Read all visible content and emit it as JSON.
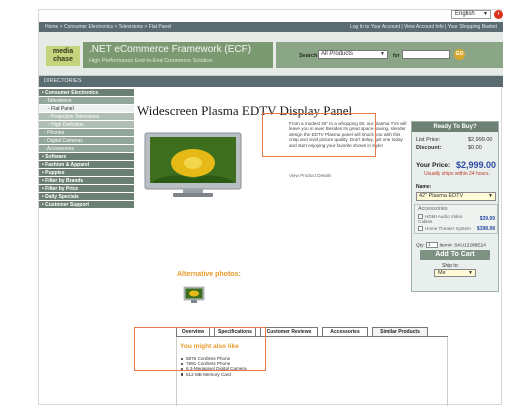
{
  "language": {
    "value": "English"
  },
  "topbar": {
    "breadcrumb": "Home > Consumer Electronics > Televisions > Flat Panel",
    "account_links": "Log In to Your Account | View Account Info | Your Shopping Basket"
  },
  "header": {
    "logo_line1": "media",
    "logo_line2": "chase",
    "brand_title": ".NET eCommerce Framework (ECF)",
    "brand_sub": "High Performance End-to-End Commerce Solution",
    "search_label": "Search",
    "search_category": "All Products",
    "for_label": "for",
    "search_value": "",
    "go_label": "GO"
  },
  "directories_label": "DIRECTORIES",
  "sidebar": {
    "items": [
      {
        "label": "Consumer Electronics",
        "level": 0
      },
      {
        "label": "Televisions",
        "level": 1
      },
      {
        "label": "Flat Panel",
        "level": 2,
        "active": true
      },
      {
        "label": "Projection Televisions",
        "level": 2
      },
      {
        "label": "High Definition",
        "level": 2
      },
      {
        "label": "Phones",
        "level": 1
      },
      {
        "label": "Digital Cameras",
        "level": 1
      },
      {
        "label": "Accessories",
        "level": 1
      },
      {
        "label": "Software",
        "level": 0
      },
      {
        "label": "Fashion & Apparel",
        "level": 0
      },
      {
        "label": "Puppies",
        "level": 0
      },
      {
        "label": "Filter by Brands",
        "level": 0
      },
      {
        "label": "Filter by Price",
        "level": 0
      },
      {
        "label": "Daily Specials",
        "level": 0
      },
      {
        "label": "Customer Support",
        "level": 0
      }
    ]
  },
  "product": {
    "title": "Widescreen Plasma EDTV Display Panel",
    "description": "From a modest 36\" to a whopping 60, our plasma TVs will leave you in awe! Besides its great space-saving, slender design the EDTV Plasma panel will shock you with this crisp and vivid picture quality. Don't delay, get one today and start enjoying your favorite shows in style!",
    "details_link": "View Product Details"
  },
  "buybox": {
    "heading": "Ready To Buy?",
    "list_price_label": "List Price:",
    "list_price": "$2,999.00",
    "discount_label": "Discount:",
    "discount": "$0.00",
    "your_price_label": "Your Price:",
    "your_price": "$2,999.00",
    "ships_note": "Usually ships within 24 hours.",
    "name_label": "Name:",
    "name_value": "42\" Plasma EDTV",
    "accessories_label": "Accessories",
    "accessories": [
      {
        "label": "HDMI Audio Video Cables",
        "price": "$39.99"
      },
      {
        "label": "Home Theater System",
        "price": "$398.98"
      }
    ],
    "qty_label": "Qty:",
    "qty_value": "1",
    "item_label": "Item#: SKU12288E24",
    "add_to_cart": "Add To Cart",
    "ship_to_label": "Ship to:",
    "ship_to_value": "Me"
  },
  "alternative_photos_label": "Alternative photos:",
  "tabs": [
    {
      "label": "Overview"
    },
    {
      "label": "Specifications"
    },
    {
      "label": "Customer Reviews"
    },
    {
      "label": "Accessories"
    },
    {
      "label": "Similar Products",
      "active": true
    }
  ],
  "might_like": {
    "title": "You might also like",
    "items": [
      "5875 Cordless Phone",
      "7891 Cordless Phone",
      "6.3-Megapixel Digital Camera",
      "512 MB Memory Card"
    ]
  },
  "colors": {
    "bar": "#5a6b72",
    "accent_orange": "#e79a2a",
    "highlight": "#e77a4a",
    "price_blue": "#2b4aa0"
  }
}
